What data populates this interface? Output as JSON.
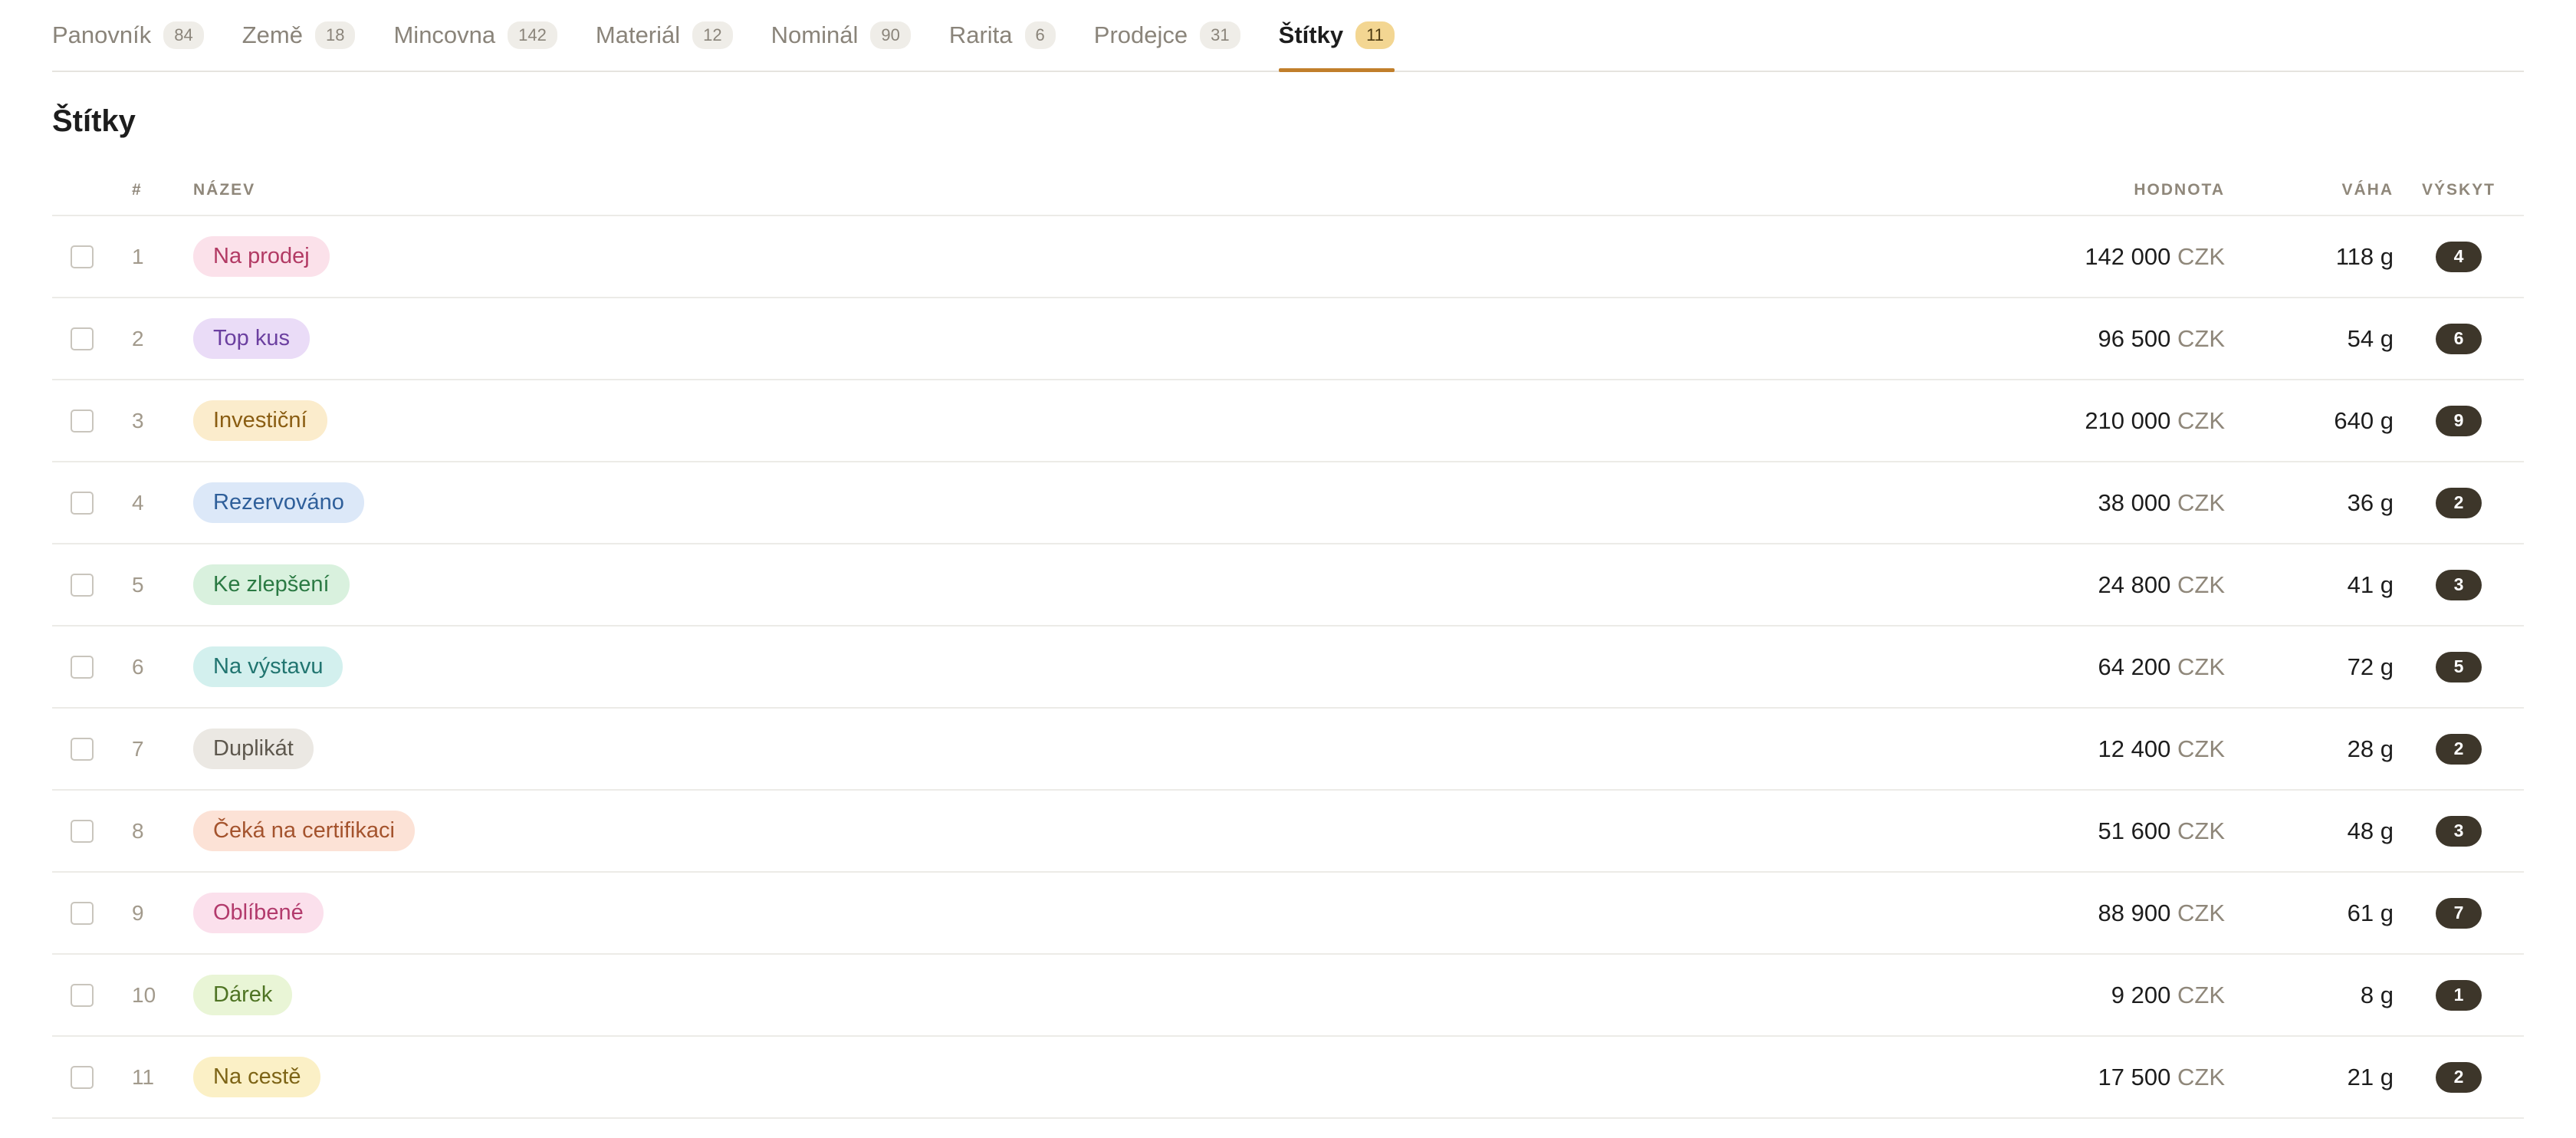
{
  "tabs": [
    {
      "label": "Panovník",
      "count": "84"
    },
    {
      "label": "Země",
      "count": "18"
    },
    {
      "label": "Mincovna",
      "count": "142"
    },
    {
      "label": "Materiál",
      "count": "12"
    },
    {
      "label": "Nominál",
      "count": "90"
    },
    {
      "label": "Rarita",
      "count": "6"
    },
    {
      "label": "Prodejce",
      "count": "31"
    },
    {
      "label": "Štítky",
      "count": "11"
    }
  ],
  "active_tab_index": 7,
  "page_title": "Štítky",
  "columns": {
    "num": "#",
    "name": "NÁZEV",
    "value": "HODNOTA",
    "weight": "VÁHA",
    "occurrence": "VÝSKYT"
  },
  "rows": [
    {
      "num": "1",
      "name": "Na prodej",
      "value": "142 000",
      "currency": "CZK",
      "weight": "118 g",
      "occurrence": "4",
      "pill_bg": "#fbe1ea",
      "pill_fg": "#b23a64"
    },
    {
      "num": "2",
      "name": "Top kus",
      "value": "96 500",
      "currency": "CZK",
      "weight": "54 g",
      "occurrence": "6",
      "pill_bg": "#eadcf7",
      "pill_fg": "#6b3fa0"
    },
    {
      "num": "3",
      "name": "Investiční",
      "value": "210 000",
      "currency": "CZK",
      "weight": "640 g",
      "occurrence": "9",
      "pill_bg": "#fbeccc",
      "pill_fg": "#8a5d12"
    },
    {
      "num": "4",
      "name": "Rezervováno",
      "value": "38 000",
      "currency": "CZK",
      "weight": "36 g",
      "occurrence": "2",
      "pill_bg": "#dce8f8",
      "pill_fg": "#2f5f9a"
    },
    {
      "num": "5",
      "name": "Ke zlepšení",
      "value": "24 800",
      "currency": "CZK",
      "weight": "41 g",
      "occurrence": "3",
      "pill_bg": "#d9f1de",
      "pill_fg": "#2b7a43"
    },
    {
      "num": "6",
      "name": "Na výstavu",
      "value": "64 200",
      "currency": "CZK",
      "weight": "72 g",
      "occurrence": "5",
      "pill_bg": "#d3f0ee",
      "pill_fg": "#217570"
    },
    {
      "num": "7",
      "name": "Duplikát",
      "value": "12 400",
      "currency": "CZK",
      "weight": "28 g",
      "occurrence": "2",
      "pill_bg": "#ebe8e3",
      "pill_fg": "#5d574d"
    },
    {
      "num": "8",
      "name": "Čeká na certifikaci",
      "value": "51 600",
      "currency": "CZK",
      "weight": "48 g",
      "occurrence": "3",
      "pill_bg": "#fce2d6",
      "pill_fg": "#a4532d"
    },
    {
      "num": "9",
      "name": "Oblíbené",
      "value": "88 900",
      "currency": "CZK",
      "weight": "61 g",
      "occurrence": "7",
      "pill_bg": "#fbe0ec",
      "pill_fg": "#b23a6c"
    },
    {
      "num": "10",
      "name": "Dárek",
      "value": "9 200",
      "currency": "CZK",
      "weight": "8 g",
      "occurrence": "1",
      "pill_bg": "#e9f5d6",
      "pill_fg": "#4f7424"
    },
    {
      "num": "11",
      "name": "Na cestě",
      "value": "17 500",
      "currency": "CZK",
      "weight": "21 g",
      "occurrence": "2",
      "pill_bg": "#fbf0c6",
      "pill_fg": "#7d6416"
    }
  ]
}
